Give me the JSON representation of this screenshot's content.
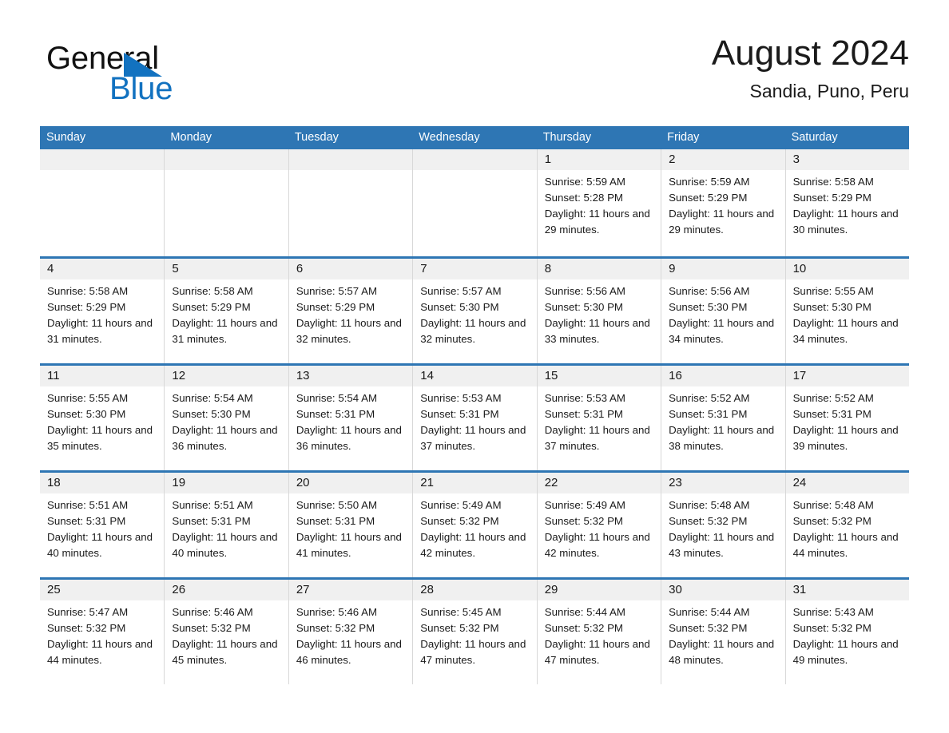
{
  "brand": {
    "name_top": "General",
    "name_bottom": "Blue",
    "accent_color": "#1272C0",
    "triangle_color": "#1272C0"
  },
  "header": {
    "title": "August 2024",
    "subtitle": "Sandia, Puno, Peru"
  },
  "theme": {
    "header_blue": "#2E76B4",
    "week_divider_blue": "#2E76B4",
    "daynum_band": "#f0f0f0",
    "grid_line": "#d8d8d8",
    "text": "#1a1a1a"
  },
  "weekdays": [
    "Sunday",
    "Monday",
    "Tuesday",
    "Wednesday",
    "Thursday",
    "Friday",
    "Saturday"
  ],
  "weeks": [
    [
      {
        "empty": true
      },
      {
        "empty": true
      },
      {
        "empty": true
      },
      {
        "empty": true
      },
      {
        "day": "1",
        "sunrise": "Sunrise: 5:59 AM",
        "sunset": "Sunset: 5:28 PM",
        "daylight": "Daylight: 11 hours and 29 minutes."
      },
      {
        "day": "2",
        "sunrise": "Sunrise: 5:59 AM",
        "sunset": "Sunset: 5:29 PM",
        "daylight": "Daylight: 11 hours and 29 minutes."
      },
      {
        "day": "3",
        "sunrise": "Sunrise: 5:58 AM",
        "sunset": "Sunset: 5:29 PM",
        "daylight": "Daylight: 11 hours and 30 minutes."
      }
    ],
    [
      {
        "day": "4",
        "sunrise": "Sunrise: 5:58 AM",
        "sunset": "Sunset: 5:29 PM",
        "daylight": "Daylight: 11 hours and 31 minutes."
      },
      {
        "day": "5",
        "sunrise": "Sunrise: 5:58 AM",
        "sunset": "Sunset: 5:29 PM",
        "daylight": "Daylight: 11 hours and 31 minutes."
      },
      {
        "day": "6",
        "sunrise": "Sunrise: 5:57 AM",
        "sunset": "Sunset: 5:29 PM",
        "daylight": "Daylight: 11 hours and 32 minutes."
      },
      {
        "day": "7",
        "sunrise": "Sunrise: 5:57 AM",
        "sunset": "Sunset: 5:30 PM",
        "daylight": "Daylight: 11 hours and 32 minutes."
      },
      {
        "day": "8",
        "sunrise": "Sunrise: 5:56 AM",
        "sunset": "Sunset: 5:30 PM",
        "daylight": "Daylight: 11 hours and 33 minutes."
      },
      {
        "day": "9",
        "sunrise": "Sunrise: 5:56 AM",
        "sunset": "Sunset: 5:30 PM",
        "daylight": "Daylight: 11 hours and 34 minutes."
      },
      {
        "day": "10",
        "sunrise": "Sunrise: 5:55 AM",
        "sunset": "Sunset: 5:30 PM",
        "daylight": "Daylight: 11 hours and 34 minutes."
      }
    ],
    [
      {
        "day": "11",
        "sunrise": "Sunrise: 5:55 AM",
        "sunset": "Sunset: 5:30 PM",
        "daylight": "Daylight: 11 hours and 35 minutes."
      },
      {
        "day": "12",
        "sunrise": "Sunrise: 5:54 AM",
        "sunset": "Sunset: 5:30 PM",
        "daylight": "Daylight: 11 hours and 36 minutes."
      },
      {
        "day": "13",
        "sunrise": "Sunrise: 5:54 AM",
        "sunset": "Sunset: 5:31 PM",
        "daylight": "Daylight: 11 hours and 36 minutes."
      },
      {
        "day": "14",
        "sunrise": "Sunrise: 5:53 AM",
        "sunset": "Sunset: 5:31 PM",
        "daylight": "Daylight: 11 hours and 37 minutes."
      },
      {
        "day": "15",
        "sunrise": "Sunrise: 5:53 AM",
        "sunset": "Sunset: 5:31 PM",
        "daylight": "Daylight: 11 hours and 37 minutes."
      },
      {
        "day": "16",
        "sunrise": "Sunrise: 5:52 AM",
        "sunset": "Sunset: 5:31 PM",
        "daylight": "Daylight: 11 hours and 38 minutes."
      },
      {
        "day": "17",
        "sunrise": "Sunrise: 5:52 AM",
        "sunset": "Sunset: 5:31 PM",
        "daylight": "Daylight: 11 hours and 39 minutes."
      }
    ],
    [
      {
        "day": "18",
        "sunrise": "Sunrise: 5:51 AM",
        "sunset": "Sunset: 5:31 PM",
        "daylight": "Daylight: 11 hours and 40 minutes."
      },
      {
        "day": "19",
        "sunrise": "Sunrise: 5:51 AM",
        "sunset": "Sunset: 5:31 PM",
        "daylight": "Daylight: 11 hours and 40 minutes."
      },
      {
        "day": "20",
        "sunrise": "Sunrise: 5:50 AM",
        "sunset": "Sunset: 5:31 PM",
        "daylight": "Daylight: 11 hours and 41 minutes."
      },
      {
        "day": "21",
        "sunrise": "Sunrise: 5:49 AM",
        "sunset": "Sunset: 5:32 PM",
        "daylight": "Daylight: 11 hours and 42 minutes."
      },
      {
        "day": "22",
        "sunrise": "Sunrise: 5:49 AM",
        "sunset": "Sunset: 5:32 PM",
        "daylight": "Daylight: 11 hours and 42 minutes."
      },
      {
        "day": "23",
        "sunrise": "Sunrise: 5:48 AM",
        "sunset": "Sunset: 5:32 PM",
        "daylight": "Daylight: 11 hours and 43 minutes."
      },
      {
        "day": "24",
        "sunrise": "Sunrise: 5:48 AM",
        "sunset": "Sunset: 5:32 PM",
        "daylight": "Daylight: 11 hours and 44 minutes."
      }
    ],
    [
      {
        "day": "25",
        "sunrise": "Sunrise: 5:47 AM",
        "sunset": "Sunset: 5:32 PM",
        "daylight": "Daylight: 11 hours and 44 minutes."
      },
      {
        "day": "26",
        "sunrise": "Sunrise: 5:46 AM",
        "sunset": "Sunset: 5:32 PM",
        "daylight": "Daylight: 11 hours and 45 minutes."
      },
      {
        "day": "27",
        "sunrise": "Sunrise: 5:46 AM",
        "sunset": "Sunset: 5:32 PM",
        "daylight": "Daylight: 11 hours and 46 minutes."
      },
      {
        "day": "28",
        "sunrise": "Sunrise: 5:45 AM",
        "sunset": "Sunset: 5:32 PM",
        "daylight": "Daylight: 11 hours and 47 minutes."
      },
      {
        "day": "29",
        "sunrise": "Sunrise: 5:44 AM",
        "sunset": "Sunset: 5:32 PM",
        "daylight": "Daylight: 11 hours and 47 minutes."
      },
      {
        "day": "30",
        "sunrise": "Sunrise: 5:44 AM",
        "sunset": "Sunset: 5:32 PM",
        "daylight": "Daylight: 11 hours and 48 minutes."
      },
      {
        "day": "31",
        "sunrise": "Sunrise: 5:43 AM",
        "sunset": "Sunset: 5:32 PM",
        "daylight": "Daylight: 11 hours and 49 minutes."
      }
    ]
  ]
}
